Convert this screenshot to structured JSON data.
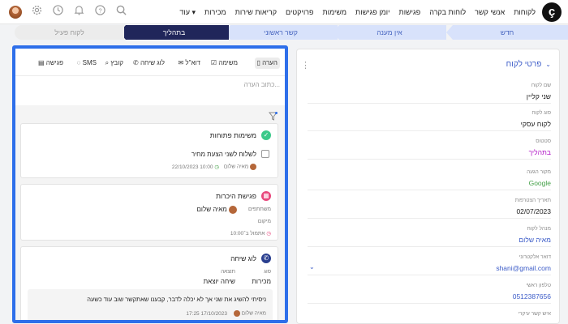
{
  "topbar": {
    "logo": "ç",
    "nav": [
      "לקוחות",
      "אנשי קשר",
      "לוחות בקרה",
      "פגישות",
      "יומן פגישות",
      "משימות",
      "פרויקטים",
      "קריאות שירות",
      "מכירות",
      "עוד ▾"
    ],
    "icons": [
      "search-icon",
      "help-icon",
      "bell-icon",
      "clock-icon",
      "gear-icon",
      "avatar"
    ]
  },
  "stages": [
    "חדש",
    "אין מענה",
    "קשר ראשוני",
    "בתהליך",
    "לקוח פעיל"
  ],
  "active_stage": "בתהליך",
  "details": {
    "title": "פרטי לקוח",
    "fields": [
      {
        "label": "שם לקוח",
        "value": "שני קליין",
        "style": ""
      },
      {
        "label": "סוג לקוח",
        "value": "לקוח עסקי",
        "style": ""
      },
      {
        "label": "סטטוס",
        "value": "בתהליך",
        "style": "purple"
      },
      {
        "label": "מקור הגעה",
        "value": "Google",
        "style": "green"
      },
      {
        "label": "תאריך הצטרפות",
        "value": "02/07/2023",
        "style": ""
      },
      {
        "label": "מנהל לקוח",
        "value": "מאיה שלום",
        "style": "blue"
      },
      {
        "label": "דואר אלקטרוני",
        "value": "shani@gmail.com",
        "style": "blue ltr"
      },
      {
        "label": "טלפון ראשי",
        "value": "0512387656",
        "style": "blue ltr"
      },
      {
        "label": "איש קשר עיקרי",
        "value": "",
        "style": ""
      }
    ]
  },
  "tabs": [
    "הערה",
    "משימה",
    "דוא\"ל",
    "לוג שיחה",
    "קובץ",
    "SMS",
    "פגישה"
  ],
  "note_placeholder": "כתוב הערה...",
  "cards": {
    "tasks": {
      "title": "משימות פתוחות",
      "item": "לשלוח לשני הצעת מחיר",
      "owner": "מאיה שלום",
      "due": "22/10/2023 10:00"
    },
    "meeting": {
      "title": "פגישת היכרות",
      "participants_label": "משתתפים",
      "participant": "מאיה שלום",
      "location_label": "מיקום",
      "reminder": "אתמול ב־10:00"
    },
    "call": {
      "title": "לוג שיחה",
      "type_label": "סוג",
      "type_value": "מכירות",
      "result_label": "תוצאה",
      "result_value": "שיחה יוצאת",
      "text": "ניסיתי להשיג את שני אך לא יכלה לדבר, קבענו שאתקשר שוב עוד כשעה",
      "owner": "מאיה שלום",
      "time": "17/10/2023 17:25"
    }
  }
}
